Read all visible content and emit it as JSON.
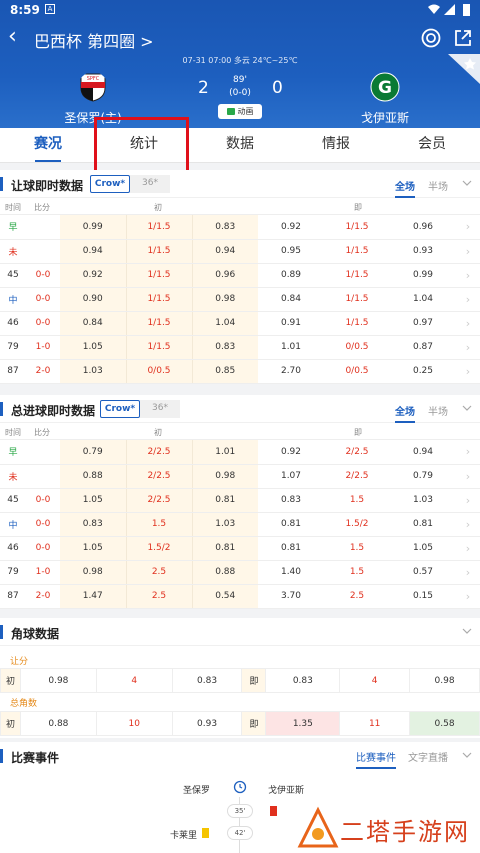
{
  "status": {
    "time": "8:59"
  },
  "header": {
    "title": "巴西杯 第四圈 >"
  },
  "match": {
    "info": "07-31 07:00   多云 24℃~25℃",
    "home": "圣保罗(主)",
    "away": "戈伊亚斯",
    "home_score": "2",
    "away_score": "0",
    "minute": "89'",
    "halftime": "(0-0)",
    "anim_label": "动画"
  },
  "tabs": [
    "赛况",
    "统计",
    "数据",
    "情报",
    "会员"
  ],
  "handicap": {
    "title": "让球即时数据",
    "chip_on": "Crow*",
    "chip_off": "36*",
    "seg_on": "全场",
    "seg_off": "半场",
    "col_time": "时间",
    "col_score": "比分",
    "col_early": "初",
    "col_live": "即",
    "rows": [
      {
        "t": "早",
        "s": "",
        "a": "0.99",
        "b": "1/1.5",
        "c": "0.83",
        "d": "0.92",
        "e": "1/1.5",
        "f": "0.96",
        "tc": "green"
      },
      {
        "t": "未",
        "s": "",
        "a": "0.94",
        "b": "1/1.5",
        "c": "0.94",
        "d": "0.95",
        "e": "1/1.5",
        "f": "0.93",
        "tc": "red"
      },
      {
        "t": "45",
        "s": "0-0",
        "a": "0.92",
        "b": "1/1.5",
        "c": "0.96",
        "d": "0.89",
        "e": "1/1.5",
        "f": "0.99",
        "tc": ""
      },
      {
        "t": "中",
        "s": "0-0",
        "a": "0.90",
        "b": "1/1.5",
        "c": "0.98",
        "d": "0.84",
        "e": "1/1.5",
        "f": "1.04",
        "tc": "blue"
      },
      {
        "t": "46",
        "s": "0-0",
        "a": "0.84",
        "b": "1/1.5",
        "c": "1.04",
        "d": "0.91",
        "e": "1/1.5",
        "f": "0.97",
        "tc": ""
      },
      {
        "t": "79",
        "s": "1-0",
        "a": "1.05",
        "b": "1/1.5",
        "c": "0.83",
        "d": "1.01",
        "e": "0/0.5",
        "f": "0.87",
        "tc": ""
      },
      {
        "t": "87",
        "s": "2-0",
        "a": "1.03",
        "b": "0/0.5",
        "c": "0.85",
        "d": "2.70",
        "e": "0/0.5",
        "f": "0.25",
        "tc": ""
      }
    ]
  },
  "totals": {
    "title": "总进球即时数据",
    "chip_on": "Crow*",
    "chip_off": "36*",
    "seg_on": "全场",
    "seg_off": "半场",
    "col_time": "时间",
    "col_score": "比分",
    "col_early": "初",
    "col_live": "即",
    "rows": [
      {
        "t": "早",
        "s": "",
        "a": "0.79",
        "b": "2/2.5",
        "c": "1.01",
        "d": "0.92",
        "e": "2/2.5",
        "f": "0.94",
        "tc": "green"
      },
      {
        "t": "未",
        "s": "",
        "a": "0.88",
        "b": "2/2.5",
        "c": "0.98",
        "d": "1.07",
        "e": "2/2.5",
        "f": "0.79",
        "tc": "red"
      },
      {
        "t": "45",
        "s": "0-0",
        "a": "1.05",
        "b": "2/2.5",
        "c": "0.81",
        "d": "0.83",
        "e": "1.5",
        "f": "1.03",
        "tc": ""
      },
      {
        "t": "中",
        "s": "0-0",
        "a": "0.83",
        "b": "1.5",
        "c": "1.03",
        "d": "0.81",
        "e": "1.5/2",
        "f": "0.81",
        "tc": "blue"
      },
      {
        "t": "46",
        "s": "0-0",
        "a": "1.05",
        "b": "1.5/2",
        "c": "0.81",
        "d": "0.81",
        "e": "1.5",
        "f": "1.05",
        "tc": ""
      },
      {
        "t": "79",
        "s": "1-0",
        "a": "0.98",
        "b": "2.5",
        "c": "0.88",
        "d": "1.40",
        "e": "1.5",
        "f": "0.57",
        "tc": ""
      },
      {
        "t": "87",
        "s": "2-0",
        "a": "1.47",
        "b": "2.5",
        "c": "0.54",
        "d": "3.70",
        "e": "2.5",
        "f": "0.15",
        "tc": ""
      }
    ]
  },
  "corners": {
    "title": "角球数据",
    "handicap_label": "让分",
    "total_label": "总角数",
    "early": "初",
    "live": "即",
    "handicap_row": {
      "a": "0.98",
      "b": "4",
      "c": "0.83",
      "d": "0.83",
      "e": "4",
      "f": "0.98"
    },
    "total_row": {
      "a": "0.88",
      "b": "10",
      "c": "0.93",
      "d": "1.35",
      "e": "11",
      "f": "0.58"
    }
  },
  "events": {
    "title": "比赛事件",
    "tab_on": "比赛事件",
    "tab_off": "文字直播",
    "home": "圣保罗",
    "away": "戈伊亚斯",
    "items": [
      {
        "minute": "35'",
        "side": "away"
      },
      {
        "minute": "42'",
        "side": "home",
        "player": "卡莱里"
      }
    ]
  },
  "watermark": "二塔手游网",
  "colors": {
    "primary": "#1d5fbf",
    "red": "#e0301e",
    "green": "#28a745",
    "accent_orange": "#e58a1a"
  }
}
